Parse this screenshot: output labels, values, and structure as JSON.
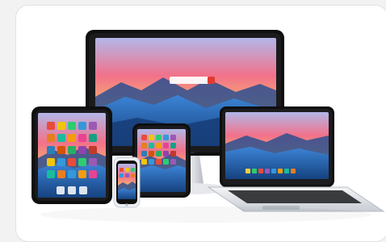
{
  "image": {
    "description_icon": "devices-photo-icon",
    "accent_colors": {
      "sky_top": "#f2718a",
      "sky_mid": "#f6b06f",
      "water": "#2b6fc4",
      "mountain": "#2d4f8f",
      "bezel": "#0f0f10",
      "laptop_base": "#d9dde2"
    }
  }
}
